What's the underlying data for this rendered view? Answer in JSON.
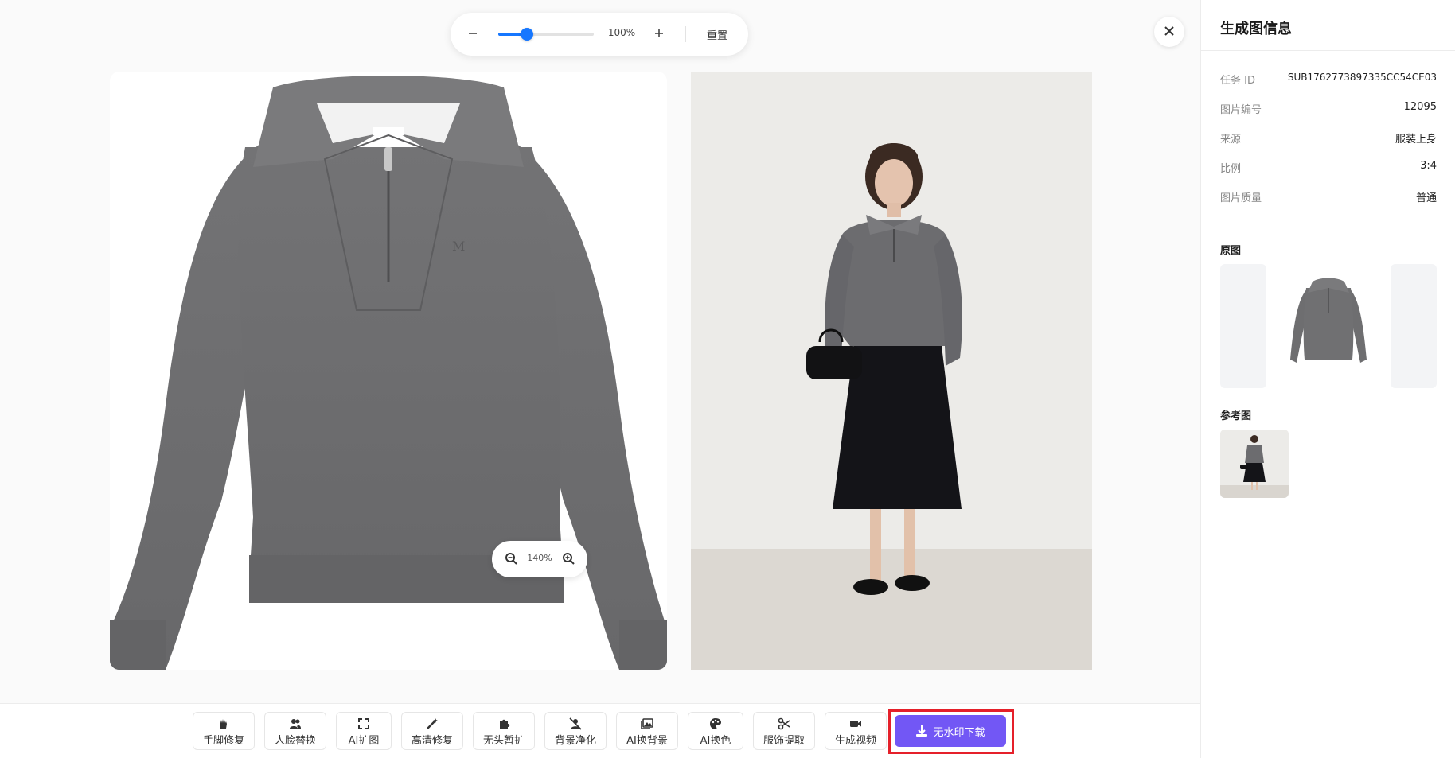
{
  "zoom_toolbar": {
    "zoom_level": "100%",
    "zoom_fraction": 0.3,
    "reset_label": "重置"
  },
  "preview": {
    "mini_zoom_level": "140%"
  },
  "tools": [
    {
      "label": "手脚修复",
      "icon": "hand-icon"
    },
    {
      "label": "人脸替换",
      "icon": "users-icon"
    },
    {
      "label": "AI扩图",
      "icon": "expand-icon"
    },
    {
      "label": "高清修复",
      "icon": "magic-wand-icon"
    },
    {
      "label": "无头暂扩",
      "icon": "puzzle-icon"
    },
    {
      "label": "背景净化",
      "icon": "user-slash-icon"
    },
    {
      "label": "AI换背景",
      "icon": "images-icon"
    },
    {
      "label": "AI换色",
      "icon": "palette-icon"
    },
    {
      "label": "服饰提取",
      "icon": "scissors-icon"
    },
    {
      "label": "生成视频",
      "icon": "video-icon"
    }
  ],
  "download": {
    "label": "无水印下载",
    "icon": "download-icon"
  },
  "panel": {
    "title": "生成图信息",
    "info": [
      {
        "key": "任务 ID",
        "value": "SUB1762773897335CC54CE03"
      },
      {
        "key": "图片编号",
        "value": "12095"
      },
      {
        "key": "来源",
        "value": "服装上身"
      },
      {
        "key": "比例",
        "value": "3:4"
      },
      {
        "key": "图片质量",
        "value": "普通"
      }
    ],
    "original_title": "原图",
    "reference_title": "参考图"
  },
  "colors": {
    "accent": "#1677ff",
    "download_button": "#7257f5",
    "highlight_border": "#e5202a",
    "sweater_gray": "#6e6e70"
  }
}
